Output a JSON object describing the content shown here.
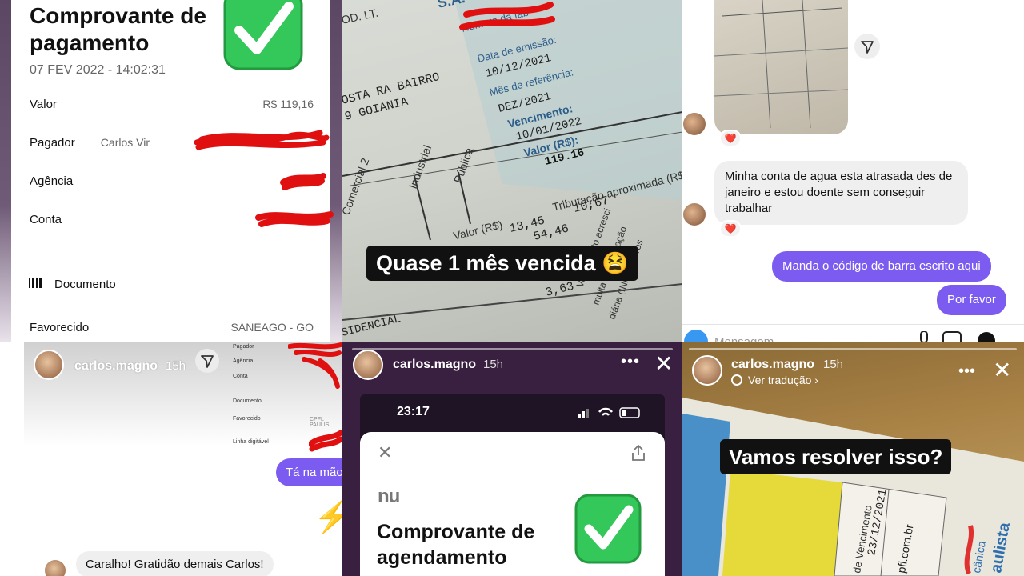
{
  "receipt": {
    "title": "Comprovante de pagamento",
    "date": "07 FEV 2022 - 14:02:31",
    "rows": [
      {
        "label": "Valor",
        "value": "R$ 119,16"
      },
      {
        "label": "Pagador",
        "value": "Carlos Vir"
      },
      {
        "label": "Agência",
        "value": ""
      },
      {
        "label": "Conta",
        "value": ""
      }
    ],
    "document_label": "Documento",
    "favorecido_label": "Favorecido",
    "favorecido_value": "SANEAGO - GO",
    "check_color": "#34c759"
  },
  "bill_story": {
    "caption": "Quase 1 mês vencida 😫",
    "text": {
      "company": "S.A.",
      "code": "OD. LT.",
      "numero_fab": "Número da fab",
      "data_emissao_label": "Data de emissão:",
      "data_emissao": "10/12/2021",
      "mes_ref_label": "Mês de referência:",
      "mes_ref": "DEZ/2021",
      "vencimento_label": "Vencimento:",
      "vencimento": "10/01/2022",
      "valor_label": "Valor (R$):",
      "valor": "119.16",
      "address_1": "OSTA RA BAIRRO",
      "address_2": "9 GOIANIA",
      "cat_1": "Comercial 2",
      "cat_2": "Industrial",
      "cat_3": "Pública",
      "valor_rs": "Valor (R$)",
      "trib": "Tributação aproximada (R$)",
      "n1": "13,45",
      "n2": "54,46",
      "n3": "3,63",
      "n4": "10,67",
      "residencial": "SIDENCIAL",
      "fine_1": "multa e atualização",
      "fine_2": "diária (INPC + juros",
      "fine_3": "Vencimento acresci"
    }
  },
  "dm": {
    "message_in": "Minha conta de agua esta atrasada des de janeiro e estou doente sem conseguir trabalhar",
    "message_out_1": "Manda o código de barra escrito aqui",
    "message_out_2": "Por favor",
    "heart": "❤️",
    "composer_placeholder": "Mensagem",
    "accent": "#7b5bf0"
  },
  "story_left": {
    "username": "carlos.magno",
    "time": "15h",
    "mini_labels": [
      "Pagador",
      "Agência",
      "Conta",
      "Documento",
      "Favorecido",
      "Linha digitável"
    ],
    "mini_value": "CPFL PAULIS",
    "reply": "Tá na mão",
    "bolt": "⚡",
    "thanks": "Caralho! Gratidão demais Carlos!"
  },
  "story_middle": {
    "username": "carlos.magno",
    "time": "15h",
    "clock": "23:17",
    "logo": "nu",
    "title": "Comprovante de agendamento"
  },
  "story_right": {
    "username": "carlos.magno",
    "time": "15h",
    "translate": "Ver tradução ›",
    "caption": "Vamos resolver isso?",
    "paper_text": {
      "venc_label": "de Vencimento",
      "venc": "23/12/2021",
      "site": "pfl.com.br",
      "brand": "aulista",
      "brand2": "cânica"
    }
  }
}
